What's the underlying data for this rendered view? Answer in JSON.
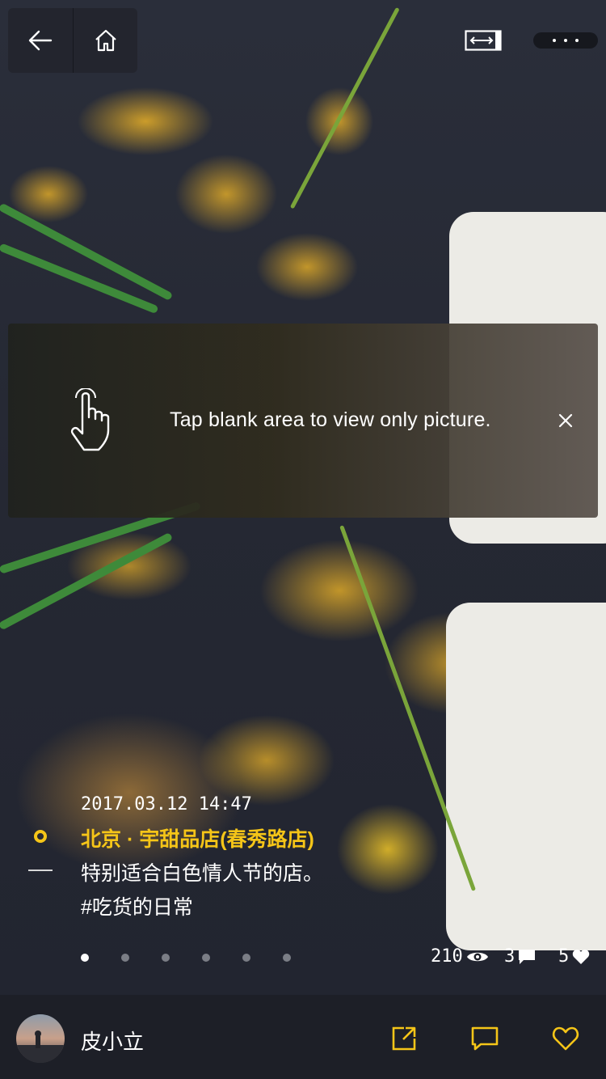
{
  "nav": {
    "back_icon": "arrow-left-icon",
    "home_icon": "home-icon",
    "fit_icon": "fit-width-icon",
    "more_icon": "more-dots-icon"
  },
  "tip": {
    "text": "Tap blank area to view only picture.",
    "hand_icon": "tap-hand-icon",
    "close_icon": "close-icon"
  },
  "post": {
    "datetime": "2017.03.12 14:47",
    "location": "北京 · 宇甜品店(春秀路店)",
    "text": "特别适合白色情人节的店。",
    "tag": "#吃货的日常"
  },
  "pagination": {
    "total": 6,
    "active": 1
  },
  "stats": {
    "views": "210",
    "comments": "3",
    "likes": "5"
  },
  "user": {
    "name": "皮小立"
  },
  "colors": {
    "accent": "#f5c518",
    "bar": "#1d1f27"
  }
}
